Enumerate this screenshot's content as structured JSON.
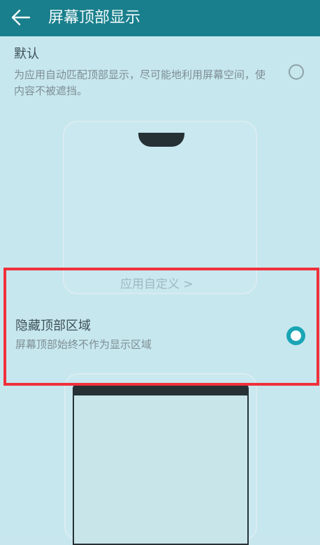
{
  "header": {
    "title": "屏幕顶部显示",
    "back_icon": "arrow-left-icon"
  },
  "options": [
    {
      "title": "默认",
      "description": "为应用自动匹配顶部显示，尽可能地利用屏幕空间，使内容不被遮挡。",
      "selected": false
    },
    {
      "title": "隐藏顶部区域",
      "description": "屏幕顶部始终不作为显示区域",
      "selected": true
    }
  ],
  "custom_link": {
    "label": "应用自定义 >"
  },
  "colors": {
    "header_bg": "#1a7f8c",
    "accent": "#1aa5b5",
    "highlight_border": "#f0303a",
    "content_bg": "#c7e7ef"
  }
}
